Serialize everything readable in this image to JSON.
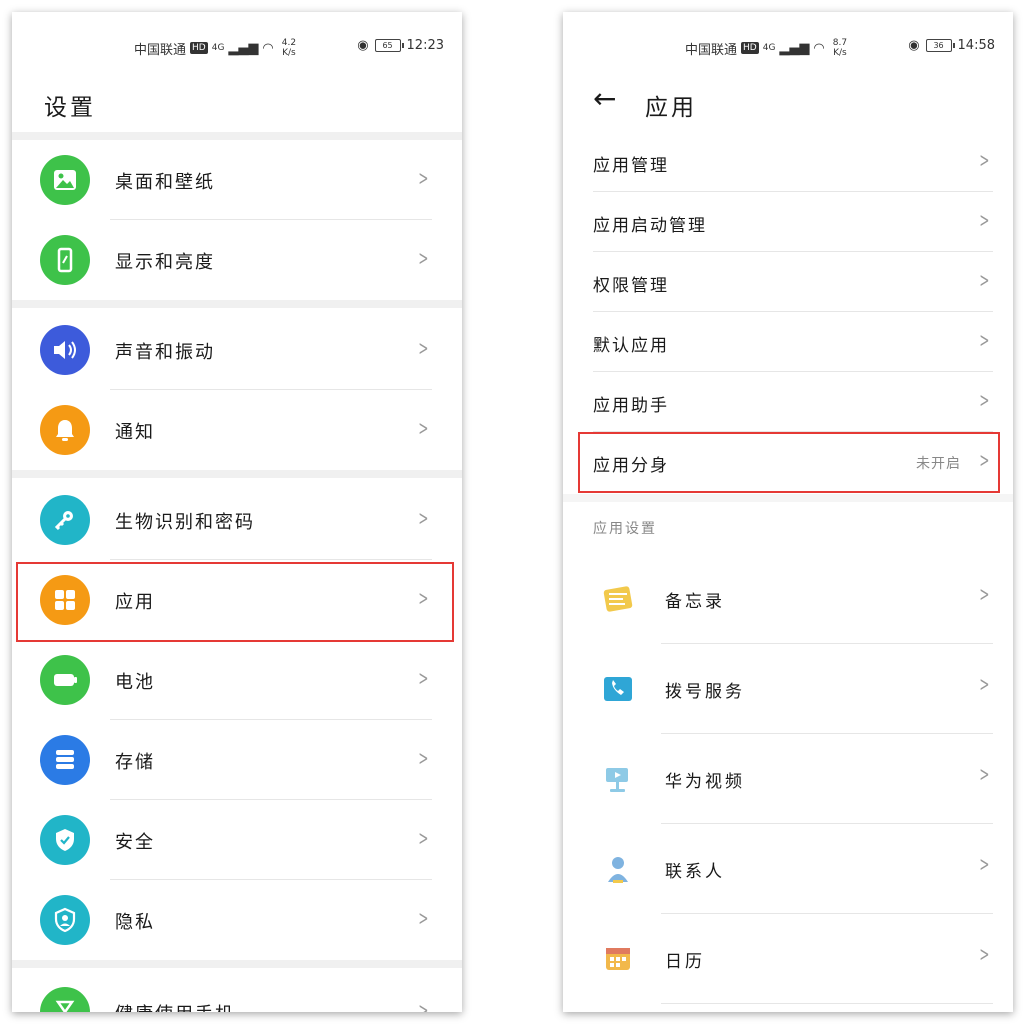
{
  "status_left": {
    "carrier": "中国联通",
    "hd": "HD",
    "network": "4G",
    "speed_value": "4.2",
    "speed_unit": "K/s",
    "battery": "65",
    "time": "12:23"
  },
  "status_right": {
    "carrier": "中国联通",
    "hd": "HD",
    "network": "4G",
    "speed_value": "8.7",
    "speed_unit": "K/s",
    "battery": "36",
    "time": "14:58"
  },
  "left": {
    "title": "设置",
    "items": [
      {
        "label": "桌面和壁纸",
        "icon": "wallpaper-icon",
        "color": "#3ec24a"
      },
      {
        "label": "显示和亮度",
        "icon": "display-icon",
        "color": "#3ec24a"
      },
      {
        "label": "声音和振动",
        "icon": "sound-icon",
        "color": "#3d5bdb"
      },
      {
        "label": "通知",
        "icon": "bell-icon",
        "color": "#f59a14"
      },
      {
        "label": "生物识别和密码",
        "icon": "key-icon",
        "color": "#21b5c8"
      },
      {
        "label": "应用",
        "icon": "apps-icon",
        "color": "#f59a14"
      },
      {
        "label": "电池",
        "icon": "battery-icon",
        "color": "#3ec24a"
      },
      {
        "label": "存储",
        "icon": "storage-icon",
        "color": "#2b7be5"
      },
      {
        "label": "安全",
        "icon": "shield-icon",
        "color": "#21b5c8"
      },
      {
        "label": "隐私",
        "icon": "privacy-icon",
        "color": "#21b5c8"
      },
      {
        "label": "健康使用手机",
        "icon": "hourglass-icon",
        "color": "#3ec24a"
      }
    ]
  },
  "right": {
    "title": "应用",
    "menu": [
      {
        "label": "应用管理",
        "value": ""
      },
      {
        "label": "应用启动管理",
        "value": ""
      },
      {
        "label": "权限管理",
        "value": ""
      },
      {
        "label": "默认应用",
        "value": ""
      },
      {
        "label": "应用助手",
        "value": ""
      },
      {
        "label": "应用分身",
        "value": "未开启"
      }
    ],
    "section": "应用设置",
    "apps": [
      {
        "label": "备忘录",
        "icon": "notepad-icon",
        "color": "#f2c94c"
      },
      {
        "label": "拨号服务",
        "icon": "phone-icon",
        "color": "#2fa6d6"
      },
      {
        "label": "华为视频",
        "icon": "video-icon",
        "color": "#8ecae6"
      },
      {
        "label": "联系人",
        "icon": "contacts-icon",
        "color": "#7fb3e0"
      },
      {
        "label": "日历",
        "icon": "calendar-icon",
        "color": "#f2b84b"
      }
    ]
  },
  "highlight_color": "#e53935"
}
